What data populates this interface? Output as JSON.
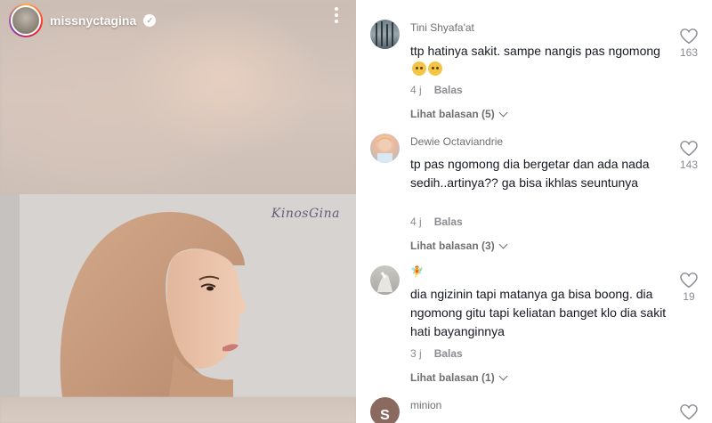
{
  "header": {
    "username": "missnyctagina",
    "verified_glyph": "✓"
  },
  "video": {
    "watermark": "KinosGina"
  },
  "comments": [
    {
      "author": "Tini Shyafa'at",
      "text": "ttp hatinya sakit. sampe nangis pas ngomong",
      "emoji_count": 2,
      "time": "4 j",
      "reply_label": "Balas",
      "replies_label": "Lihat balasan (5)",
      "likes": "163"
    },
    {
      "author": "Dewie Octaviandrie",
      "text": "tp pas ngomong dia bergetar dan ada nada sedih..artinya?? ga bisa ikhlas seuntunya",
      "time": "4 j",
      "reply_label": "Balas",
      "replies_label": "Lihat balasan (3)",
      "likes": "143"
    },
    {
      "author_glyph": "🧚",
      "text": "dia ngizinin tapi matanya ga bisa boong. dia ngomong gitu tapi keliatan banget klo dia sakit hati bayanginnya",
      "time": "3 j",
      "reply_label": "Balas",
      "replies_label": "Lihat balasan (1)",
      "likes": "19"
    },
    {
      "author": "minion",
      "avatar_letter": "S"
    }
  ],
  "colors": {
    "text_primary": "#161823",
    "text_secondary": "#6f6f6f",
    "meta": "#8a8b91"
  },
  "icons": [
    "verified-badge-icon",
    "more-options-icon",
    "heart-icon",
    "chevron-down-icon"
  ]
}
